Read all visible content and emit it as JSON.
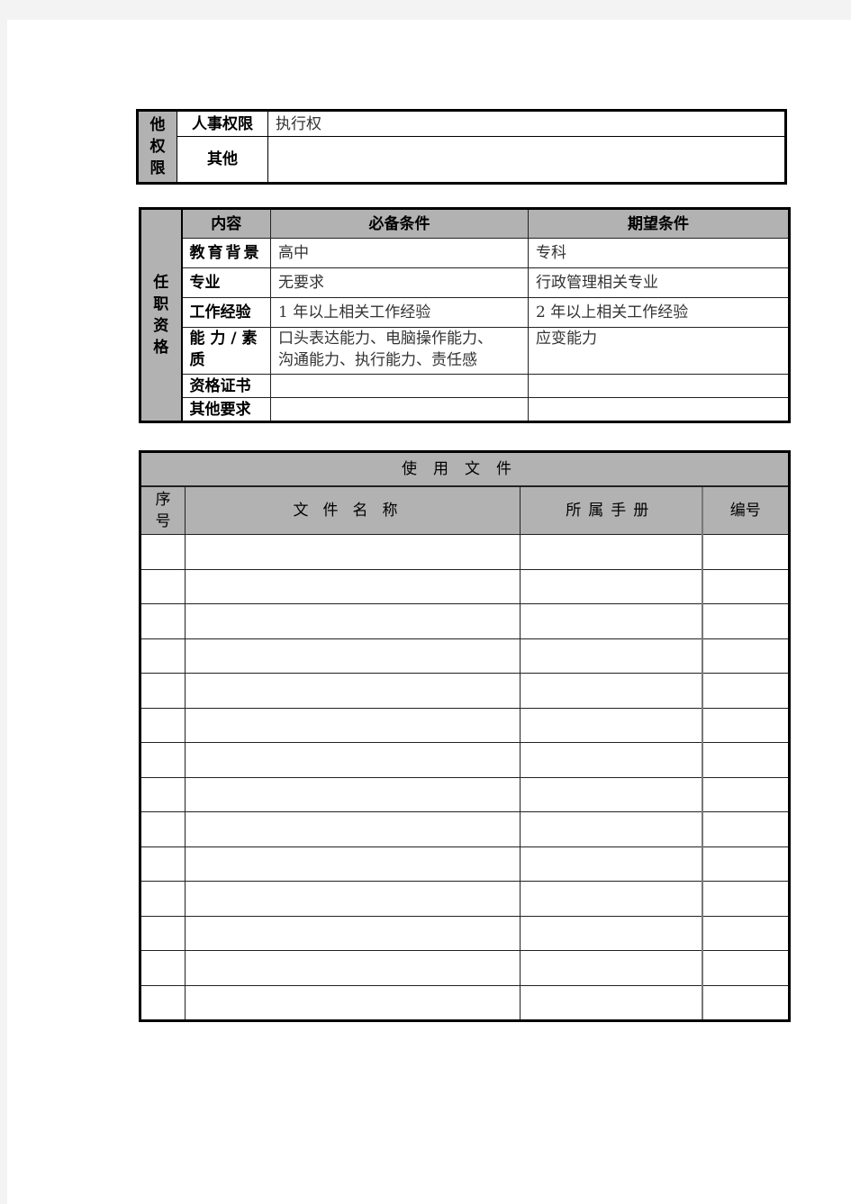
{
  "authority_table": {
    "section_label": "他权限",
    "section_chars": [
      "他",
      "权",
      "限"
    ],
    "rows": [
      {
        "label": "人事权限",
        "value": "执行权"
      },
      {
        "label": "其他",
        "value": ""
      }
    ]
  },
  "qualification_table": {
    "section_chars": [
      "任",
      "职",
      "资",
      "格"
    ],
    "headers": {
      "content": "内容",
      "required": "必备条件",
      "expected": "期望条件"
    },
    "rows": [
      {
        "item": "教育背景",
        "required": "高中",
        "expected": "专科"
      },
      {
        "item": "专业",
        "required": "无要求",
        "expected": "行政管理相关专业"
      },
      {
        "item": "工作经验",
        "required": "1 年以上相关工作经验",
        "expected": "2 年以上相关工作经验"
      },
      {
        "item_line1": "能 力 / 素",
        "item_line2": "质",
        "required_line1": "口头表达能力、电脑操作能力、",
        "required_line2": "沟通能力、执行能力、责任感",
        "expected": "应变能力"
      },
      {
        "item": "资格证书",
        "required": "",
        "expected": ""
      },
      {
        "item": "其他要求",
        "required": "",
        "expected": ""
      }
    ]
  },
  "documents_table": {
    "title": "使用文件",
    "headers": {
      "index_line1": "序",
      "index_line2": "号",
      "name": "文件名称",
      "manual": "所属手册",
      "number": "编号"
    },
    "rows": [
      {
        "index": "",
        "name": "",
        "manual": "",
        "number": ""
      },
      {
        "index": "",
        "name": "",
        "manual": "",
        "number": ""
      },
      {
        "index": "",
        "name": "",
        "manual": "",
        "number": ""
      },
      {
        "index": "",
        "name": "",
        "manual": "",
        "number": ""
      },
      {
        "index": "",
        "name": "",
        "manual": "",
        "number": ""
      },
      {
        "index": "",
        "name": "",
        "manual": "",
        "number": ""
      },
      {
        "index": "",
        "name": "",
        "manual": "",
        "number": ""
      },
      {
        "index": "",
        "name": "",
        "manual": "",
        "number": ""
      },
      {
        "index": "",
        "name": "",
        "manual": "",
        "number": ""
      },
      {
        "index": "",
        "name": "",
        "manual": "",
        "number": ""
      },
      {
        "index": "",
        "name": "",
        "manual": "",
        "number": ""
      },
      {
        "index": "",
        "name": "",
        "manual": "",
        "number": ""
      },
      {
        "index": "",
        "name": "",
        "manual": "",
        "number": ""
      },
      {
        "index": "",
        "name": "",
        "manual": "",
        "number": ""
      }
    ]
  }
}
